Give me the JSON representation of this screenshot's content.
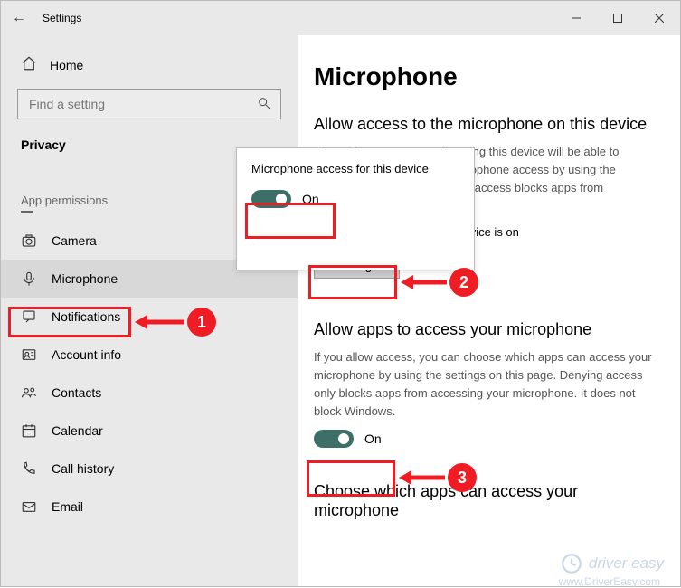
{
  "window": {
    "title": "Settings"
  },
  "sidebar": {
    "home": "Home",
    "search_placeholder": "Find a setting",
    "section": "Privacy",
    "group": "App permissions",
    "items": [
      {
        "label": "Camera"
      },
      {
        "label": "Microphone"
      },
      {
        "label": "Notifications"
      },
      {
        "label": "Account info"
      },
      {
        "label": "Contacts"
      },
      {
        "label": "Calendar"
      },
      {
        "label": "Call history"
      },
      {
        "label": "Email"
      }
    ]
  },
  "main": {
    "heading": "Microphone",
    "section1": {
      "title": "Allow access to the microphone on this device",
      "body": "If you allow access, people using this device will be able to choose if their apps have microphone access by using the settings on this page. Denying access blocks apps from accessing the microphone.",
      "status": "Microphone access for this device is on",
      "change": "Change"
    },
    "section2": {
      "title": "Allow apps to access your microphone",
      "body": "If you allow access, you can choose which apps can access your microphone by using the settings on this page. Denying access only blocks apps from accessing your microphone. It does not block Windows.",
      "toggle_label": "On"
    },
    "section3": {
      "title": "Choose which apps can access your microphone"
    }
  },
  "flyout": {
    "title": "Microphone access for this device",
    "toggle_label": "On"
  },
  "watermark": {
    "brand": "driver easy",
    "url": "www.DriverEasy.com"
  }
}
